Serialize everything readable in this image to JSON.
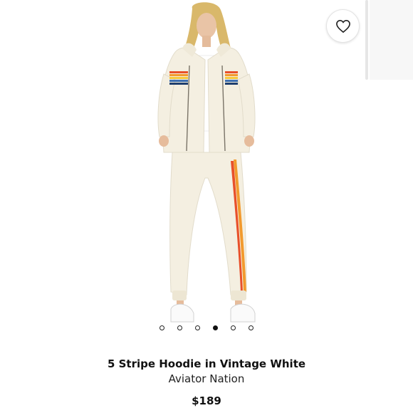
{
  "product": {
    "title": "5 Stripe Hoodie in Vintage White",
    "brand": "Aviator Nation",
    "price": "$189"
  },
  "gallery": {
    "image_count": 6,
    "active_index": 3,
    "favorite_icon": "heart-outline-icon"
  },
  "colors": {
    "cream": "#f4efe1",
    "stripe": [
      "#e8502a",
      "#f29a2e",
      "#f6c93f",
      "#3e6fb0",
      "#1f3f6e"
    ]
  }
}
